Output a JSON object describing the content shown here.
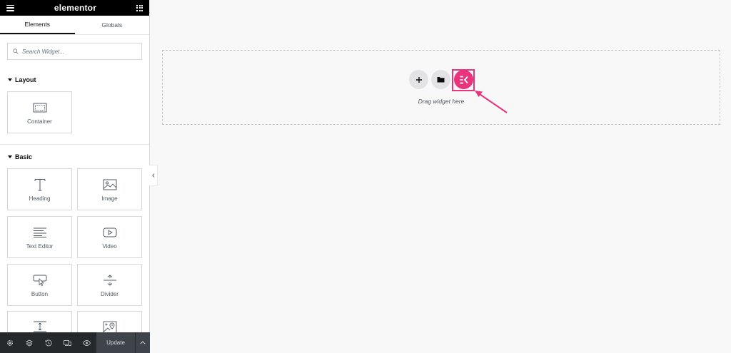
{
  "app": {
    "logo": "elementor"
  },
  "tabs": [
    {
      "label": "Elements",
      "active": true
    },
    {
      "label": "Globals",
      "active": false
    }
  ],
  "search": {
    "placeholder": "Search Widget..."
  },
  "categories": {
    "layout": {
      "title": "Layout",
      "widgets": [
        {
          "label": "Container",
          "icon": "container-icon"
        }
      ]
    },
    "basic": {
      "title": "Basic",
      "widgets": [
        {
          "label": "Heading",
          "icon": "heading-icon"
        },
        {
          "label": "Image",
          "icon": "image-icon"
        },
        {
          "label": "Text Editor",
          "icon": "text-editor-icon"
        },
        {
          "label": "Video",
          "icon": "video-icon"
        },
        {
          "label": "Button",
          "icon": "button-icon"
        },
        {
          "label": "Divider",
          "icon": "divider-icon"
        },
        {
          "label": "",
          "icon": "spacer-icon"
        },
        {
          "label": "",
          "icon": "google-maps-icon"
        }
      ]
    }
  },
  "bottombar": {
    "icons": [
      "settings-icon",
      "layers-icon",
      "history-icon",
      "responsive-icon",
      "preview-icon"
    ],
    "update_label": "Update"
  },
  "canvas": {
    "drag_text": "Drag widget here",
    "buttons": [
      "add-section-icon",
      "template-library-icon",
      "elementskit-icon"
    ]
  },
  "colors": {
    "accent": "#e9337b",
    "topbar": "#000000",
    "bottombar": "#26292c"
  }
}
